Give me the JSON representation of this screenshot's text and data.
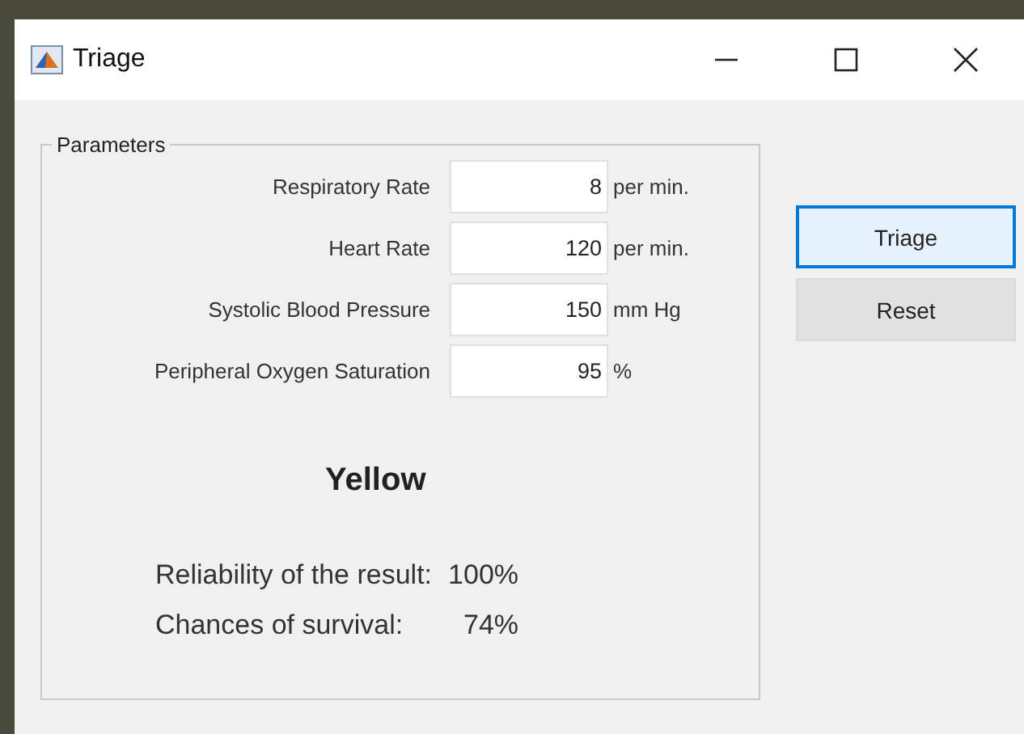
{
  "window": {
    "title": "Triage",
    "controls": [
      {
        "kind": "minimize"
      },
      {
        "kind": "maximize"
      },
      {
        "kind": "close"
      }
    ]
  },
  "panel": {
    "title": "Parameters",
    "fields": [
      {
        "label": "Respiratory Rate",
        "value": "8",
        "unit": "per min."
      },
      {
        "label": "Heart Rate",
        "value": "120",
        "unit": "per min."
      },
      {
        "label": "Systolic Blood Pressure",
        "value": "150",
        "unit": "mm Hg"
      },
      {
        "label": "Peripheral Oxygen Saturation",
        "value": "95",
        "unit": "%"
      }
    ],
    "result": "Yellow",
    "stats": [
      {
        "label": "Reliability of the result:",
        "value": "100%"
      },
      {
        "label": "Chances of survival:",
        "value": "74%"
      }
    ]
  },
  "buttons": [
    {
      "label": "Triage",
      "focused": true
    },
    {
      "label": "Reset",
      "focused": false
    }
  ]
}
